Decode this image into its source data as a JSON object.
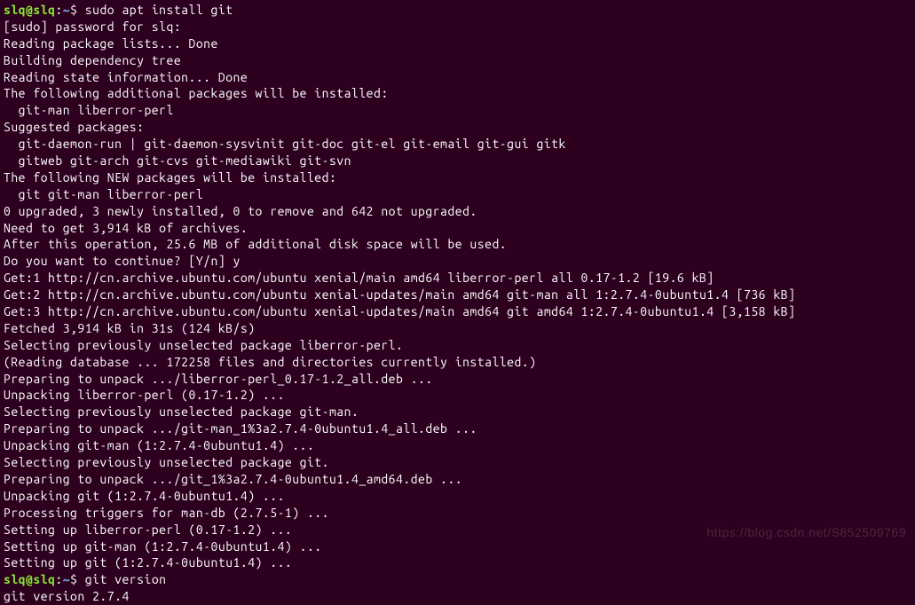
{
  "prompt1": {
    "user_host": "slq@slq",
    "separator": ":",
    "path": "~",
    "dollar": "$ ",
    "command": "sudo apt install git"
  },
  "lines": [
    "[sudo] password for slq:",
    "Reading package lists... Done",
    "Building dependency tree",
    "Reading state information... Done",
    "The following additional packages will be installed:",
    "  git-man liberror-perl",
    "Suggested packages:",
    "  git-daemon-run | git-daemon-sysvinit git-doc git-el git-email git-gui gitk",
    "  gitweb git-arch git-cvs git-mediawiki git-svn",
    "The following NEW packages will be installed:",
    "  git git-man liberror-perl",
    "0 upgraded, 3 newly installed, 0 to remove and 642 not upgraded.",
    "Need to get 3,914 kB of archives.",
    "After this operation, 25.6 MB of additional disk space will be used.",
    "Do you want to continue? [Y/n] y",
    "Get:1 http://cn.archive.ubuntu.com/ubuntu xenial/main amd64 liberror-perl all 0.17-1.2 [19.6 kB]",
    "Get:2 http://cn.archive.ubuntu.com/ubuntu xenial-updates/main amd64 git-man all 1:2.7.4-0ubuntu1.4 [736 kB]",
    "Get:3 http://cn.archive.ubuntu.com/ubuntu xenial-updates/main amd64 git amd64 1:2.7.4-0ubuntu1.4 [3,158 kB]",
    "Fetched 3,914 kB in 31s (124 kB/s)",
    "Selecting previously unselected package liberror-perl.",
    "(Reading database ... 172258 files and directories currently installed.)",
    "Preparing to unpack .../liberror-perl_0.17-1.2_all.deb ...",
    "Unpacking liberror-perl (0.17-1.2) ...",
    "Selecting previously unselected package git-man.",
    "Preparing to unpack .../git-man_1%3a2.7.4-0ubuntu1.4_all.deb ...",
    "Unpacking git-man (1:2.7.4-0ubuntu1.4) ...",
    "Selecting previously unselected package git.",
    "Preparing to unpack .../git_1%3a2.7.4-0ubuntu1.4_amd64.deb ...",
    "Unpacking git (1:2.7.4-0ubuntu1.4) ...",
    "Processing triggers for man-db (2.7.5-1) ...",
    "Setting up liberror-perl (0.17-1.2) ...",
    "Setting up git-man (1:2.7.4-0ubuntu1.4) ...",
    "Setting up git (1:2.7.4-0ubuntu1.4) ..."
  ],
  "prompt2": {
    "user_host": "slq@slq",
    "separator": ":",
    "path": "~",
    "dollar": "$ ",
    "command": "git version"
  },
  "version_output": "git version 2.7.4",
  "watermark": "https://blog.csdn.net/S852509769"
}
